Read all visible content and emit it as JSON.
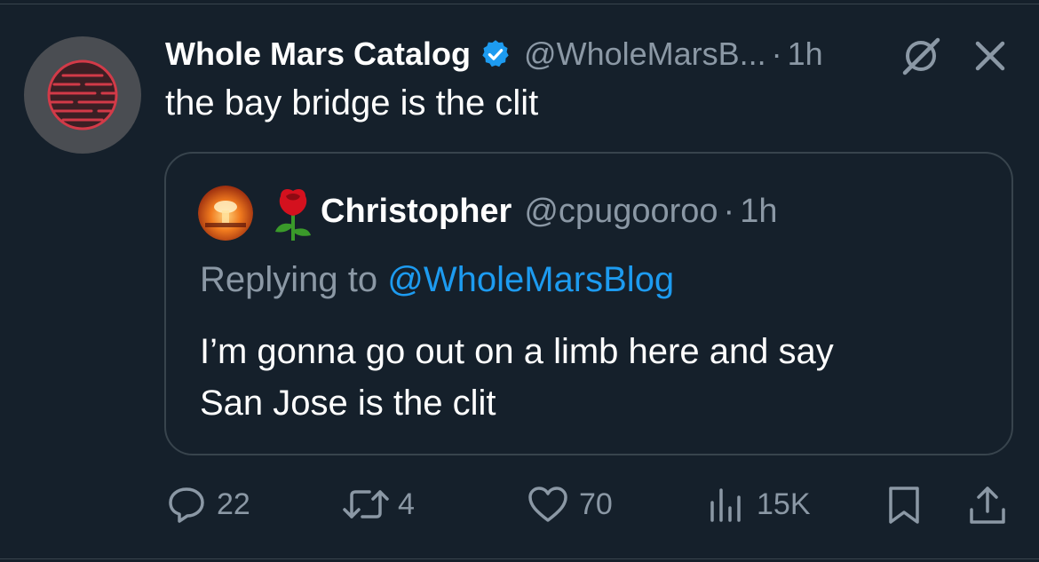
{
  "tweet": {
    "author_name": "Whole Mars Catalog",
    "author_handle": "@WholeMarsB...",
    "separator": "·",
    "time": "1h",
    "text": "the bay bridge is the clit"
  },
  "quoted": {
    "author_name": "Christopher",
    "author_handle": "@cpugooroo",
    "separator": "·",
    "time": "1h",
    "replying_prefix": "Replying to",
    "replying_to": "@WholeMarsBlog",
    "text_line1": "I’m gonna go out on a limb here and say",
    "text_line2": "San Jose is the clit",
    "name_emoji": "rose-emoji"
  },
  "actions": {
    "replies": "22",
    "retweets": "4",
    "likes": "70",
    "views": "15K"
  },
  "icons": {
    "verified": "verified-badge-icon",
    "grok": "grok-icon",
    "close": "close-icon",
    "reply": "reply-icon",
    "retweet": "retweet-icon",
    "like": "like-icon",
    "views": "views-icon",
    "bookmark": "bookmark-icon",
    "share": "share-icon"
  },
  "colors": {
    "background": "#15202b",
    "text": "#ffffff",
    "secondary": "#8b98a5",
    "accent": "#1d9bf0",
    "border": "#38444d"
  }
}
